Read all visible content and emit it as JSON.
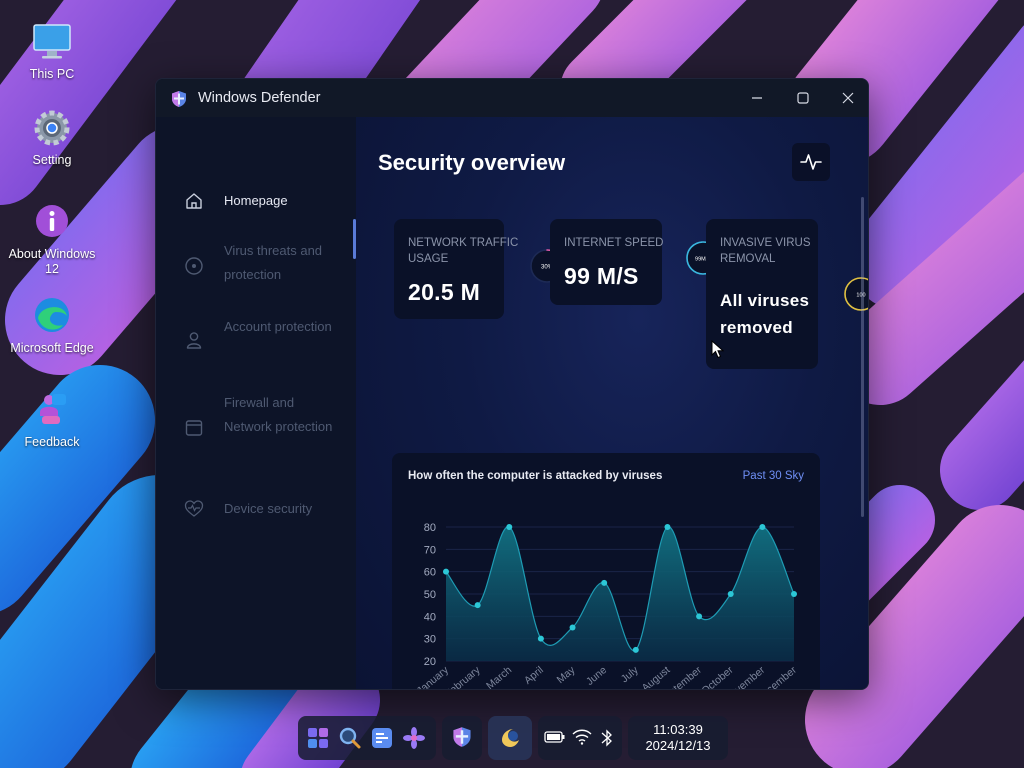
{
  "desktop": {
    "icons": [
      {
        "label": "This PC"
      },
      {
        "label": "Setting"
      },
      {
        "label": "About Windows 12"
      },
      {
        "label": "Microsoft Edge"
      },
      {
        "label": "Feedback"
      }
    ]
  },
  "window": {
    "title": "Windows Defender",
    "controls": {
      "minimize": "minimize-icon",
      "maximize": "maximize-icon",
      "close": "close-icon"
    }
  },
  "sidebar": {
    "items": [
      {
        "label": "Homepage",
        "icon": "home-icon",
        "active": true
      },
      {
        "label": "Virus threats and protection",
        "icon": "target-icon",
        "active": false
      },
      {
        "label": "Account protection",
        "icon": "user-icon",
        "active": false
      },
      {
        "label": "Firewall and Network protection",
        "icon": "window-icon",
        "active": false
      },
      {
        "label": "Device security",
        "icon": "heartbeat-icon",
        "active": false
      }
    ]
  },
  "main": {
    "title": "Security overview",
    "cards": [
      {
        "label": "NETWORK TRAFFIC USAGE",
        "value": "20.5 M",
        "ring_text": "30%",
        "ring_fraction": 0.3
      },
      {
        "label": "INTERNET SPEED",
        "value": "99 M/S",
        "ring_text": "99M/S",
        "ring_fraction": 0.99
      },
      {
        "label": "INVASIVE VIRUS REMOVAL",
        "value": "All viruses removed",
        "ring_text": "100",
        "ring_fraction": 1.0
      }
    ]
  },
  "chart": {
    "range_label": "Past 30 Sky"
  },
  "chart_data": {
    "type": "area",
    "title": "How often the computer is attacked by viruses",
    "categories": [
      "January",
      "February",
      "March",
      "April",
      "May",
      "June",
      "July",
      "August",
      "September",
      "October",
      "November",
      "December"
    ],
    "values": [
      60,
      45,
      80,
      30,
      35,
      55,
      25,
      80,
      40,
      50,
      80,
      50
    ],
    "yticks": [
      80,
      70,
      60,
      50,
      40,
      30,
      20
    ],
    "ylim": [
      20,
      80
    ],
    "grid": true,
    "colors": {
      "line": "#1e8fa8",
      "fill": "#0f5a6e",
      "point": "#2cc7d6"
    }
  },
  "taskbar": {
    "time": "11:03:39",
    "date": "2024/12/13"
  },
  "colors": {
    "accent": "#5a7bd8",
    "window_bg": "#0b1229",
    "card_bg": "#0a1128",
    "link": "#6f8ff5"
  }
}
